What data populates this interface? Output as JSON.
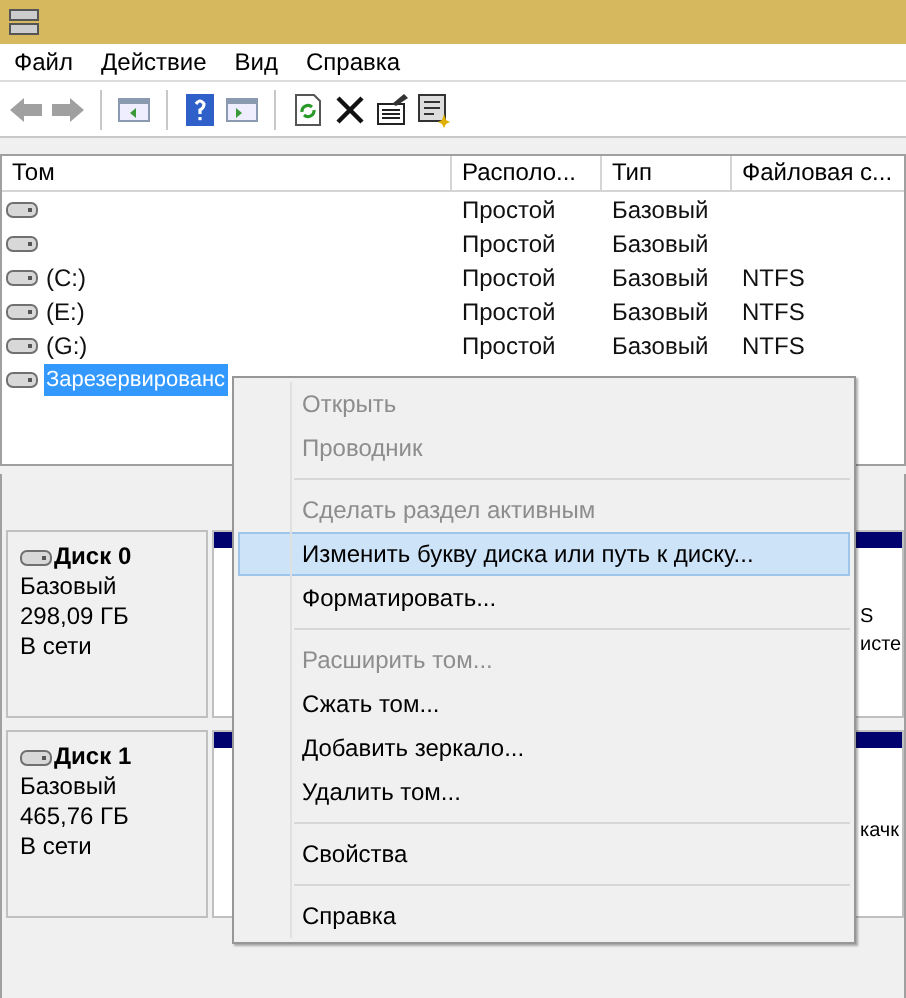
{
  "menu_bar": [
    "Файл",
    "Действие",
    "Вид",
    "Справка"
  ],
  "toolbar": [
    {
      "kind": "back"
    },
    {
      "kind": "forward"
    },
    {
      "kind": "sep"
    },
    {
      "kind": "panel-left"
    },
    {
      "kind": "sep"
    },
    {
      "kind": "help"
    },
    {
      "kind": "panel-right"
    },
    {
      "kind": "sep"
    },
    {
      "kind": "refresh"
    },
    {
      "kind": "delete"
    },
    {
      "kind": "properties"
    },
    {
      "kind": "wizard"
    }
  ],
  "table": {
    "columns": [
      "Том",
      "Располо...",
      "Тип",
      "Файловая с..."
    ],
    "rows": [
      {
        "name": "",
        "layout": "Простой",
        "type": "Базовый",
        "fs": "",
        "selected": false
      },
      {
        "name": "",
        "layout": "Простой",
        "type": "Базовый",
        "fs": "",
        "selected": false
      },
      {
        "name": "(C:)",
        "layout": "Простой",
        "type": "Базовый",
        "fs": "NTFS",
        "selected": false
      },
      {
        "name": "(E:)",
        "layout": "Простой",
        "type": "Базовый",
        "fs": "NTFS",
        "selected": false
      },
      {
        "name": "(G:)",
        "layout": "Простой",
        "type": "Базовый",
        "fs": "NTFS",
        "selected": false
      },
      {
        "name": "Зарезервированс",
        "layout": "",
        "type": "",
        "fs": "",
        "selected": true
      }
    ]
  },
  "disks": [
    {
      "name": "Диск 0",
      "type": "Базовый",
      "size": "298,09 ГБ",
      "status": "В сети",
      "partition_text": [
        "S",
        "исте"
      ]
    },
    {
      "name": "Диск 1",
      "type": "Базовый",
      "size": "465,76 ГБ",
      "status": "В сети",
      "partition_text": [
        "качк"
      ]
    }
  ],
  "context_menu": [
    {
      "kind": "item",
      "label": "Открыть",
      "disabled": true,
      "selected": false
    },
    {
      "kind": "item",
      "label": "Проводник",
      "disabled": true,
      "selected": false
    },
    {
      "kind": "sep"
    },
    {
      "kind": "item",
      "label": "Сделать раздел активным",
      "disabled": true,
      "selected": false
    },
    {
      "kind": "item",
      "label": "Изменить букву диска или путь к диску...",
      "disabled": false,
      "selected": true
    },
    {
      "kind": "item",
      "label": "Форматировать...",
      "disabled": false,
      "selected": false
    },
    {
      "kind": "sep"
    },
    {
      "kind": "item",
      "label": "Расширить том...",
      "disabled": true,
      "selected": false
    },
    {
      "kind": "item",
      "label": "Сжать том...",
      "disabled": false,
      "selected": false
    },
    {
      "kind": "item",
      "label": "Добавить зеркало...",
      "disabled": false,
      "selected": false
    },
    {
      "kind": "item",
      "label": "Удалить том...",
      "disabled": false,
      "selected": false
    },
    {
      "kind": "sep"
    },
    {
      "kind": "item",
      "label": "Свойства",
      "disabled": false,
      "selected": false
    },
    {
      "kind": "sep"
    },
    {
      "kind": "item",
      "label": "Справка",
      "disabled": false,
      "selected": false
    }
  ]
}
